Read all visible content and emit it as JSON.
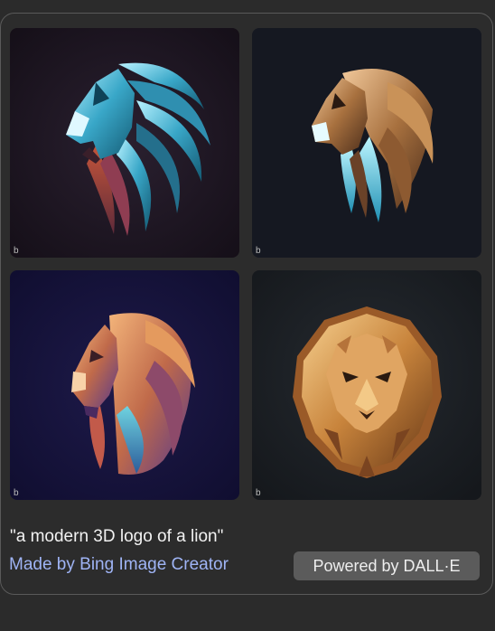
{
  "images": [
    {
      "id": "lion-1",
      "watermark": "b",
      "palette": "teal",
      "background": "#1a1620"
    },
    {
      "id": "lion-2",
      "watermark": "b",
      "palette": "bronze-cyan",
      "background": "#151821"
    },
    {
      "id": "lion-3",
      "watermark": "b",
      "palette": "sunset",
      "background": "#14123a"
    },
    {
      "id": "lion-4",
      "watermark": "b",
      "palette": "gold",
      "background": "#181b20"
    }
  ],
  "prompt": "\"a modern 3D logo of a lion\"",
  "footer": {
    "made_by": "Made by Bing Image Creator",
    "powered_by": "Powered by DALL·E"
  },
  "colors": {
    "accent_link": "#9fb4f5",
    "button_bg": "#5b5b5b"
  }
}
